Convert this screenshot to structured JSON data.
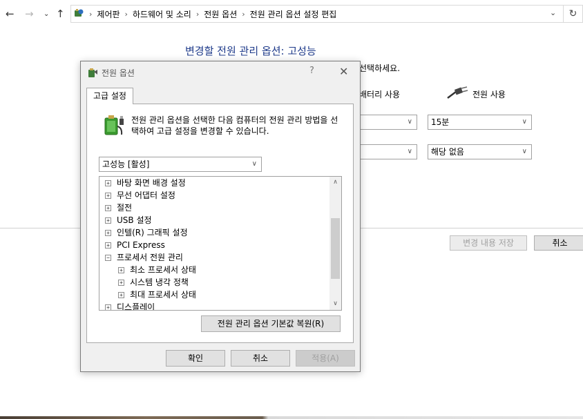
{
  "address_bar": {
    "breadcrumbs": [
      "제어판",
      "하드웨어 및 소리",
      "전원 옵션",
      "전원 관리 옵션 설정 편집"
    ]
  },
  "background_page": {
    "title": "변경할 전원 관리 옵션: 고성능",
    "instruction_partial": "선택하세요.",
    "battery_label_partial": "배터리 사용",
    "plugged_label": "전원 사용",
    "display_off_plugged": "15분",
    "sleep_plugged": "해당 없음",
    "save_label": "변경 내용 저장",
    "cancel_label": "취소"
  },
  "dialog": {
    "title": "전원 옵션",
    "help": "?",
    "tab": "고급 설정",
    "description": "전원 관리 옵션을 선택한 다음 컴퓨터의 전원 관리 방법을 선택하여 고급 설정을 변경할 수 있습니다.",
    "plan_select": "고성능 [활성]",
    "tree": [
      {
        "label": "바탕 화면 배경 설정",
        "expander": "+"
      },
      {
        "label": "무선 어댑터 설정",
        "expander": "+"
      },
      {
        "label": "절전",
        "expander": "+"
      },
      {
        "label": "USB 설정",
        "expander": "+"
      },
      {
        "label": "인텔(R) 그래픽 설정",
        "expander": "+"
      },
      {
        "label": "PCI Express",
        "expander": "+"
      },
      {
        "label": "프로세서 전원 관리",
        "expander": "−"
      },
      {
        "label": "최소 프로세서 상태",
        "expander": "+"
      },
      {
        "label": "시스템 냉각 정책",
        "expander": "+"
      },
      {
        "label": "최대 프로세서 상태",
        "expander": "+"
      },
      {
        "label": "디스플레이",
        "expander": "+"
      }
    ],
    "restore_label": "전원 관리 옵션 기본값 복원(R)",
    "ok_label": "확인",
    "cancel_label": "취소",
    "apply_label": "적용(A)"
  }
}
